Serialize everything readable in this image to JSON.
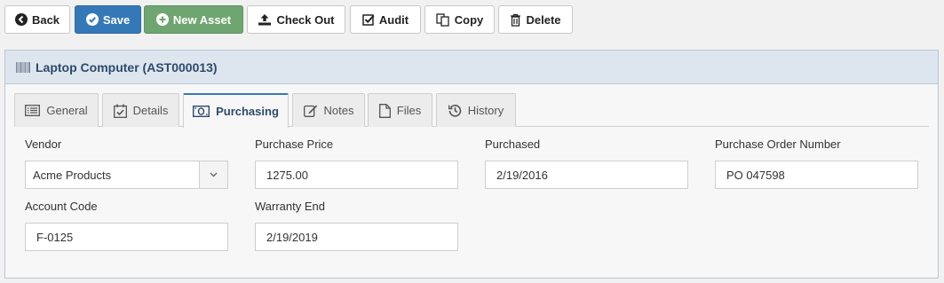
{
  "toolbar": {
    "back_label": "Back",
    "save_label": "Save",
    "new_asset_label": "New Asset",
    "check_out_label": "Check Out",
    "audit_label": "Audit",
    "copy_label": "Copy",
    "delete_label": "Delete"
  },
  "panel": {
    "title": "Laptop Computer (AST000013)",
    "icon": "barcode-icon"
  },
  "tabs": [
    {
      "label": "General",
      "icon": "list-icon"
    },
    {
      "label": "Details",
      "icon": "calendar-check-icon"
    },
    {
      "label": "Purchasing",
      "icon": "money-icon"
    },
    {
      "label": "Notes",
      "icon": "edit-icon"
    },
    {
      "label": "Files",
      "icon": "file-icon"
    },
    {
      "label": "History",
      "icon": "history-icon"
    }
  ],
  "active_tab": "Purchasing",
  "form": {
    "vendor": {
      "label": "Vendor",
      "value": "Acme Products"
    },
    "purchase_price": {
      "label": "Purchase Price",
      "value": "1275.00"
    },
    "purchased": {
      "label": "Purchased",
      "value": "2/19/2016"
    },
    "po_number": {
      "label": "Purchase Order Number",
      "value": "PO 047598"
    },
    "account_code": {
      "label": "Account Code",
      "value": "F-0125"
    },
    "warranty_end": {
      "label": "Warranty End",
      "value": "2/19/2019"
    }
  },
  "colors": {
    "primary": "#3578b8",
    "success": "#6fa570",
    "panel_header": "#dde6ef",
    "title_text": "#2d4a6b"
  }
}
